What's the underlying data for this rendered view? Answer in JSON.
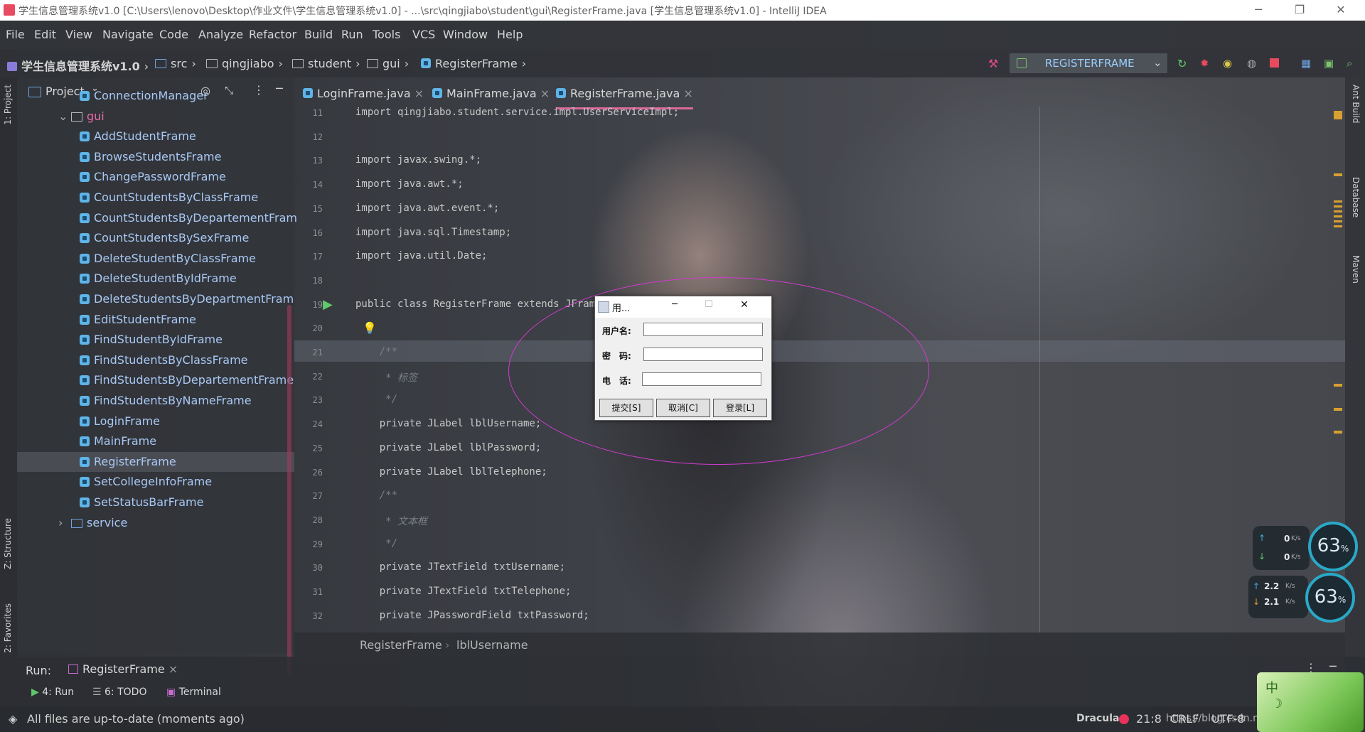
{
  "window": {
    "title": "学生信息管理系统v1.0 [C:\\Users\\lenovo\\Desktop\\作业文件\\学生信息管理系统v1.0] - ...\\src\\qingjiabo\\student\\gui\\RegisterFrame.java [学生信息管理系统v1.0] - IntelliJ IDEA",
    "minimize": "─",
    "restore": "❐",
    "close": "✕"
  },
  "menu": [
    "File",
    "Edit",
    "View",
    "Navigate",
    "Code",
    "Analyze",
    "Refactor",
    "Build",
    "Run",
    "Tools",
    "VCS",
    "Window",
    "Help"
  ],
  "nav": {
    "project": "学生信息管理系统v1.0",
    "crumbs": [
      "src",
      "qingjiabo",
      "student",
      "gui",
      "RegisterFrame"
    ],
    "run_config": "REGISTERFRAME"
  },
  "side_tabs": {
    "project": "1: Project",
    "structure": "Z: Structure",
    "favorites": "2: Favorites",
    "ant": "Ant Build",
    "database": "Database",
    "maven": "Maven"
  },
  "project_panel": {
    "title": "Project",
    "items": [
      {
        "label": "ConnectionManager",
        "type": "class",
        "indent": 2
      },
      {
        "label": "gui",
        "type": "folder",
        "indent": 1
      },
      {
        "label": "AddStudentFrame",
        "type": "class",
        "indent": 2
      },
      {
        "label": "BrowseStudentsFrame",
        "type": "class",
        "indent": 2
      },
      {
        "label": "ChangePasswordFrame",
        "type": "class",
        "indent": 2
      },
      {
        "label": "CountStudentsByClassFrame",
        "type": "class",
        "indent": 2
      },
      {
        "label": "CountStudentsByDepartementFram",
        "type": "class",
        "indent": 2
      },
      {
        "label": "CountStudentsBySexFrame",
        "type": "class",
        "indent": 2
      },
      {
        "label": "DeleteStudentByClassFrame",
        "type": "class",
        "indent": 2
      },
      {
        "label": "DeleteStudentByIdFrame",
        "type": "class",
        "indent": 2
      },
      {
        "label": "DeleteStudentsByDepartmentFram",
        "type": "class",
        "indent": 2
      },
      {
        "label": "EditStudentFrame",
        "type": "class",
        "indent": 2
      },
      {
        "label": "FindStudentByIdFrame",
        "type": "class",
        "indent": 2
      },
      {
        "label": "FindStudentsByClassFrame",
        "type": "class",
        "indent": 2
      },
      {
        "label": "FindStudentsByDepartementFrame",
        "type": "class",
        "indent": 2
      },
      {
        "label": "FindStudentsByNameFrame",
        "type": "class",
        "indent": 2
      },
      {
        "label": "LoginFrame",
        "type": "class",
        "indent": 2
      },
      {
        "label": "MainFrame",
        "type": "class",
        "indent": 2
      },
      {
        "label": "RegisterFrame",
        "type": "class",
        "indent": 2,
        "selected": true
      },
      {
        "label": "SetCollegeInfoFrame",
        "type": "class",
        "indent": 2
      },
      {
        "label": "SetStatusBarFrame",
        "type": "class",
        "indent": 2
      },
      {
        "label": "service",
        "type": "folder",
        "indent": 1
      }
    ]
  },
  "editor_tabs": [
    {
      "label": "LoginFrame.java",
      "close": "×"
    },
    {
      "label": "MainFrame.java",
      "close": "×"
    },
    {
      "label": "RegisterFrame.java",
      "close": "×",
      "active": true
    }
  ],
  "code": {
    "line_numbers": [
      "11",
      "12",
      "13",
      "14",
      "15",
      "16",
      "17",
      "18",
      "19",
      "20",
      "21",
      "22",
      "23",
      "24",
      "25",
      "26",
      "27",
      "28",
      "29",
      "30",
      "31",
      "32"
    ],
    "lines": [
      "import qingjiabo.student.service.impl.UserServiceImpl;",
      "",
      "import javax.swing.*;",
      "import java.awt.*;",
      "import java.awt.event.*;",
      "import java.sql.Timestamp;",
      "import java.util.Date;",
      "",
      "public class RegisterFrame extends JFrame",
      "",
      "    /**",
      "     * 标签",
      "     */",
      "    private JLabel lblUsername;",
      "    private JLabel lblPassword;",
      "    private JLabel lblTelephone;",
      "    /**",
      "     * 文本框",
      "     */",
      "    private JTextField txtUsername;",
      "    private JTextField txtTelephone;",
      "    private JPasswordField txtPassword;"
    ]
  },
  "breadcrumb": [
    "RegisterFrame",
    "lblUsername"
  ],
  "dialog": {
    "title": "用...",
    "minimize": "─",
    "maximize": "☐",
    "close": "✕",
    "labels": [
      "用户名:",
      "密　码:",
      "电　话:"
    ],
    "buttons": [
      "提交[S]",
      "取消[C]",
      "登录[L]"
    ]
  },
  "run_panel": {
    "label": "Run:",
    "tab": "RegisterFrame",
    "tab_close": "×",
    "tools": [
      "4: Run",
      "6: TODO",
      "Terminal"
    ]
  },
  "status": {
    "message": "All files are up-to-date (moments ago)",
    "theme": "Dracula",
    "position": "21:8",
    "line_sep": "CRLF",
    "encoding": "UTF-8",
    "watermark": "https://blog.csdn.net/weixin_44202489"
  },
  "net_widget": {
    "up1": "0",
    "down1": "0",
    "unit1": "K/s",
    "gauge1": "63",
    "up2": "2.2",
    "down2": "2.1",
    "unit2": "K/s",
    "gauge2": "63",
    "percent": "%"
  },
  "ime": {
    "label": "中"
  },
  "colors": {
    "accent": "#d96a9a",
    "link": "#a8c8f4",
    "ellipse": "#d23ad0",
    "keyword": "#e8a25a"
  }
}
